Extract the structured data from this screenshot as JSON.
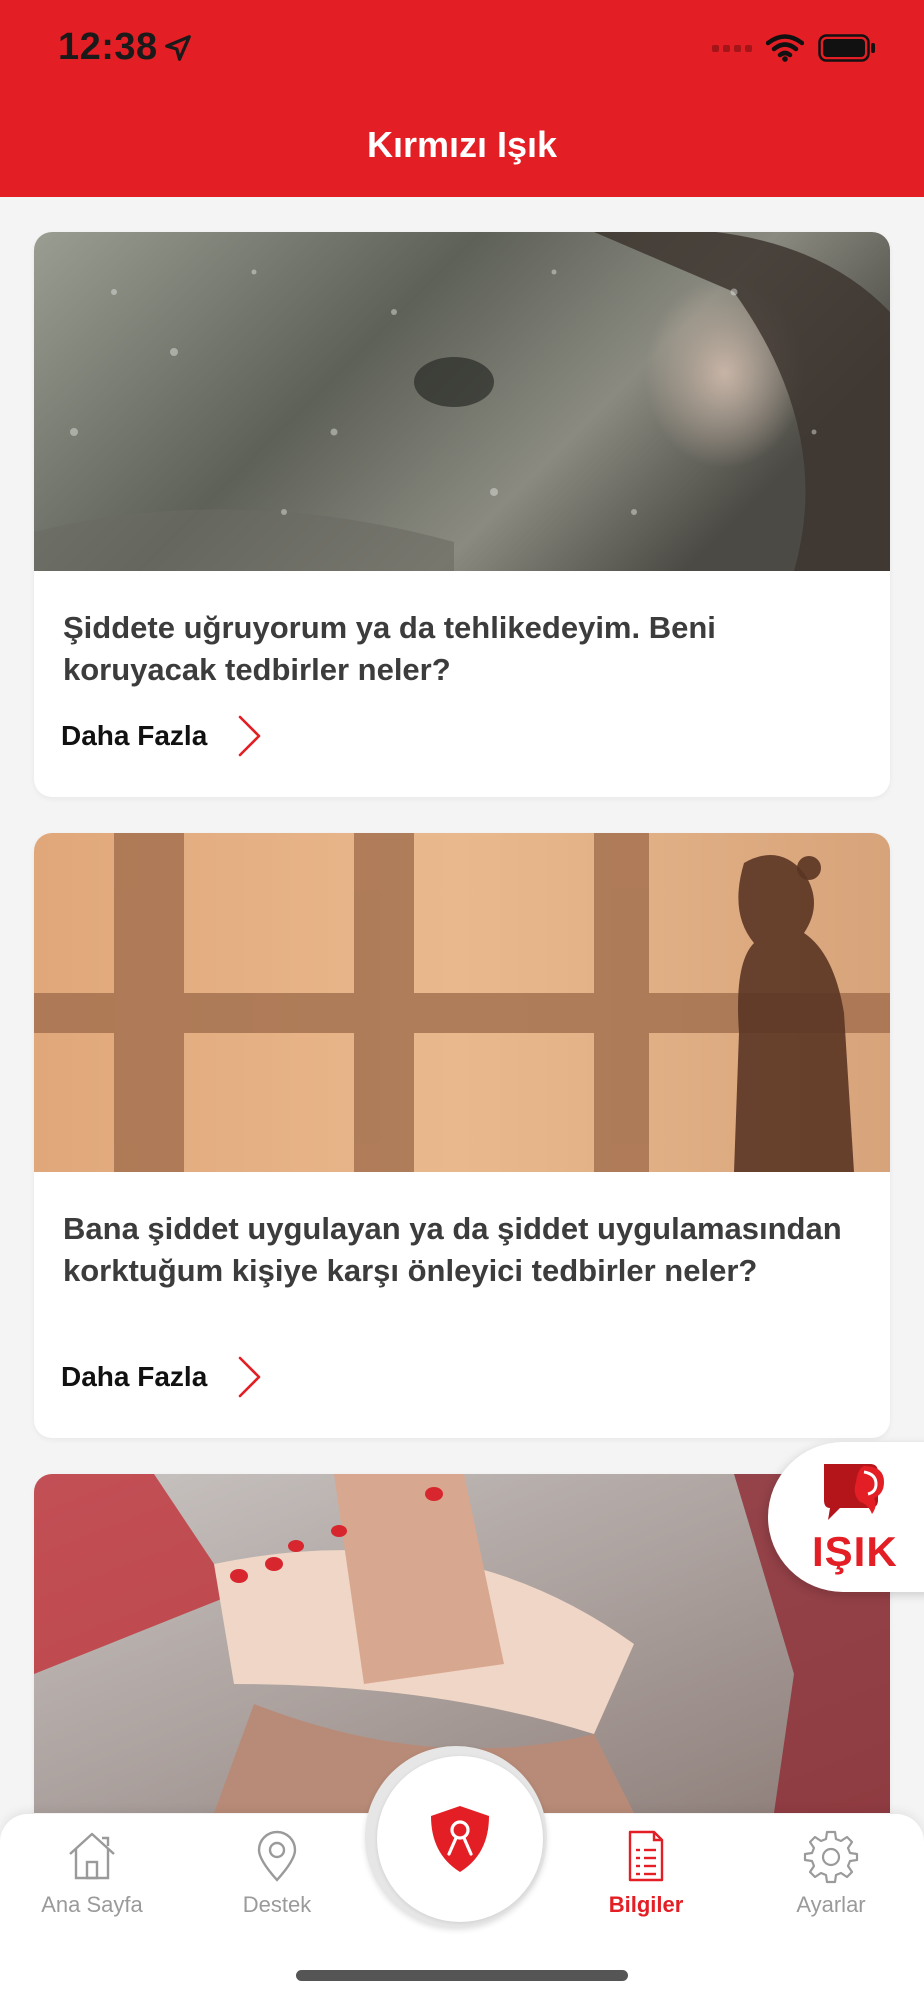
{
  "status_bar": {
    "time": "12:38",
    "icons": [
      "location-arrow-icon",
      "signal-icon",
      "wifi-icon",
      "battery-icon"
    ]
  },
  "header": {
    "title": "Kırmızı Işık",
    "color": "#e31e24"
  },
  "cards": [
    {
      "image": "woman-behind-rainy-window-photo",
      "title": "Şiddete uğruyorum ya da tehlikedeyim. Beni koruyacak tedbirler neler?",
      "more_label": "Daha Fazla"
    },
    {
      "image": "woman-silhouette-window-shadow-photo",
      "title": "Bana şiddet uygulayan ya da şiddet uygulamasından korktuğum kişiye karşı önleyici tedbirler neler?",
      "more_label": "Daha Fazla"
    },
    {
      "image": "stacked-hands-photo"
    }
  ],
  "isik_button": {
    "label": "IŞIK",
    "icon": "isik-logo-icon"
  },
  "tabbar": {
    "items": [
      {
        "label": "Ana Sayfa",
        "icon": "home-icon",
        "active": false
      },
      {
        "label": "Destek",
        "icon": "location-pin-icon",
        "active": false
      },
      {
        "label": "Bilgiler",
        "icon": "document-list-icon",
        "active": true
      },
      {
        "label": "Ayarlar",
        "icon": "gear-icon",
        "active": false
      }
    ],
    "center_icon": "shield-person-icon"
  },
  "colors": {
    "accent": "#e31e24",
    "inactive_tab": "#9a9a9a",
    "background": "#f4f4f4"
  }
}
